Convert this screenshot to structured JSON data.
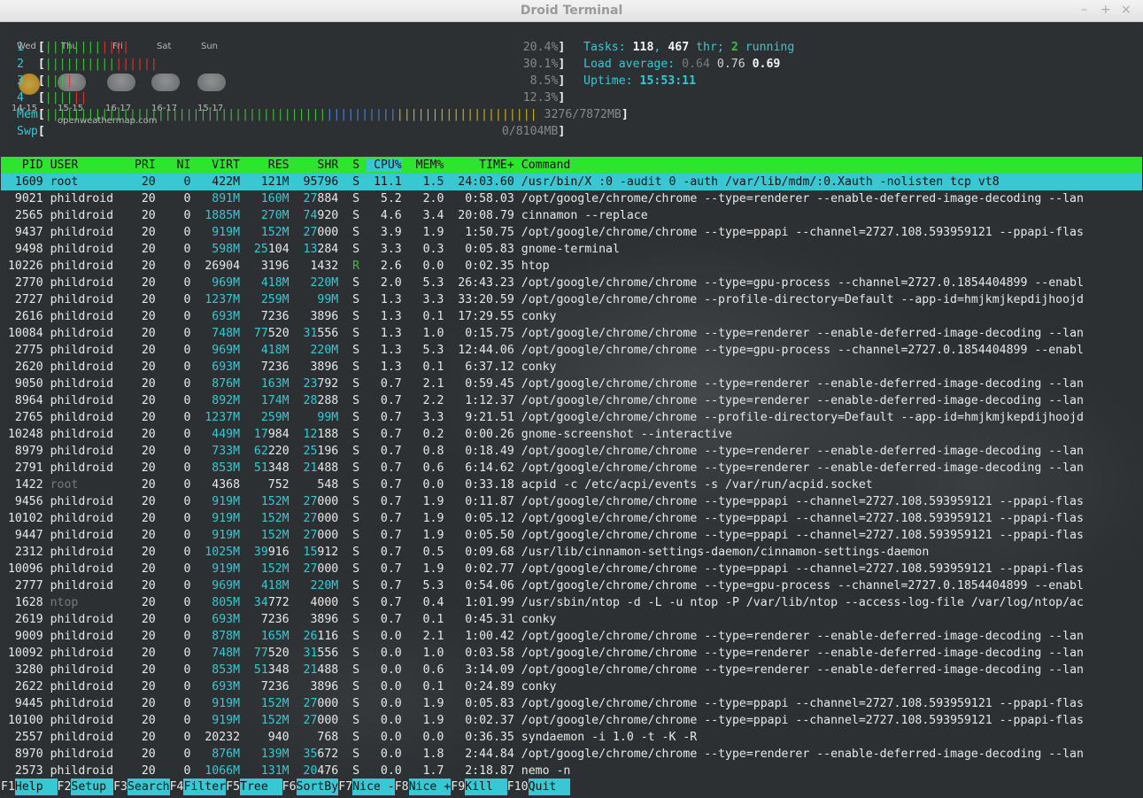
{
  "window": {
    "title": "Droid Terminal",
    "controls": [
      "–",
      "+",
      "×"
    ]
  },
  "weather": {
    "days": [
      "Wed",
      "Thu",
      "Fri",
      "Sat",
      "Sun"
    ],
    "ranges": [
      "14-15",
      "15-15",
      "16-17",
      "16-17",
      "15-17"
    ],
    "source": "openweathermap.com"
  },
  "meters": [
    {
      "label": "1",
      "value": "20.4%"
    },
    {
      "label": "2",
      "value": "30.1%"
    },
    {
      "label": "3",
      "value": "8.5%"
    },
    {
      "label": "4",
      "value": "12.3%"
    },
    {
      "label": "Mem",
      "value": "3276/7872MB"
    },
    {
      "label": "Swp",
      "value": "0/8104MB"
    }
  ],
  "stats": {
    "tasks_label": "Tasks:",
    "tasks": "118",
    "threads": "467",
    "thr_label": "thr;",
    "running": "2",
    "running_label": "running",
    "load_label": "Load average:",
    "load1": "0.64",
    "load5": "0.76",
    "load15": "0.69",
    "uptime_label": "Uptime:",
    "uptime": "15:53:11"
  },
  "columns": [
    "PID",
    "USER",
    "PRI",
    "NI",
    "VIRT",
    "RES",
    "SHR",
    "S",
    "CPU%",
    "MEM%",
    "TIME+",
    "Command"
  ],
  "processes": [
    [
      "1609",
      "root",
      "20",
      "0",
      "422M",
      "121M",
      "95796",
      "S",
      "11.1",
      "1.5",
      "24:03.60",
      "/usr/bin/X :0 -audit 0 -auth /var/lib/mdm/:0.Xauth -nolisten tcp vt8"
    ],
    [
      "9021",
      "phildroid",
      "20",
      "0",
      "891M",
      "160M",
      "27884",
      "S",
      "5.2",
      "2.0",
      "0:58.03",
      "/opt/google/chrome/chrome --type=renderer --enable-deferred-image-decoding --lan"
    ],
    [
      "2565",
      "phildroid",
      "20",
      "0",
      "1885M",
      "270M",
      "74920",
      "S",
      "4.6",
      "3.4",
      "20:08.79",
      "cinnamon --replace"
    ],
    [
      "9437",
      "phildroid",
      "20",
      "0",
      "919M",
      "152M",
      "27000",
      "S",
      "3.9",
      "1.9",
      "1:50.75",
      "/opt/google/chrome/chrome --type=ppapi --channel=2727.108.593959121 --ppapi-flas"
    ],
    [
      "9498",
      "phildroid",
      "20",
      "0",
      "598M",
      "25104",
      "13284",
      "S",
      "3.3",
      "0.3",
      "0:05.83",
      "gnome-terminal"
    ],
    [
      "10226",
      "phildroid",
      "20",
      "0",
      "26904",
      "3196",
      "1432",
      "R",
      "2.6",
      "0.0",
      "0:02.35",
      "htop"
    ],
    [
      "2770",
      "phildroid",
      "20",
      "0",
      "969M",
      "418M",
      "220M",
      "S",
      "2.0",
      "5.3",
      "26:43.23",
      "/opt/google/chrome/chrome --type=gpu-process --channel=2727.0.1854404899 --enabl"
    ],
    [
      "2727",
      "phildroid",
      "20",
      "0",
      "1237M",
      "259M",
      "99M",
      "S",
      "1.3",
      "3.3",
      "33:20.59",
      "/opt/google/chrome/chrome --profile-directory=Default --app-id=hmjkmjkepdijhoojd"
    ],
    [
      "2616",
      "phildroid",
      "20",
      "0",
      "693M",
      "7236",
      "3896",
      "S",
      "1.3",
      "0.1",
      "17:29.55",
      "conky"
    ],
    [
      "10084",
      "phildroid",
      "20",
      "0",
      "748M",
      "77520",
      "31556",
      "S",
      "1.3",
      "1.0",
      "0:15.75",
      "/opt/google/chrome/chrome --type=renderer --enable-deferred-image-decoding --lan"
    ],
    [
      "2775",
      "phildroid",
      "20",
      "0",
      "969M",
      "418M",
      "220M",
      "S",
      "1.3",
      "5.3",
      "12:44.06",
      "/opt/google/chrome/chrome --type=gpu-process --channel=2727.0.1854404899 --enabl"
    ],
    [
      "2620",
      "phildroid",
      "20",
      "0",
      "693M",
      "7236",
      "3896",
      "S",
      "1.3",
      "0.1",
      "6:37.12",
      "conky"
    ],
    [
      "9050",
      "phildroid",
      "20",
      "0",
      "876M",
      "163M",
      "23792",
      "S",
      "0.7",
      "2.1",
      "0:59.45",
      "/opt/google/chrome/chrome --type=renderer --enable-deferred-image-decoding --lan"
    ],
    [
      "8964",
      "phildroid",
      "20",
      "0",
      "892M",
      "174M",
      "28288",
      "S",
      "0.7",
      "2.2",
      "1:12.37",
      "/opt/google/chrome/chrome --type=renderer --enable-deferred-image-decoding --lan"
    ],
    [
      "2765",
      "phildroid",
      "20",
      "0",
      "1237M",
      "259M",
      "99M",
      "S",
      "0.7",
      "3.3",
      "9:21.51",
      "/opt/google/chrome/chrome --profile-directory=Default --app-id=hmjkmjkepdijhoojd"
    ],
    [
      "10248",
      "phildroid",
      "20",
      "0",
      "449M",
      "17984",
      "12188",
      "S",
      "0.7",
      "0.2",
      "0:00.26",
      "gnome-screenshot --interactive"
    ],
    [
      "8979",
      "phildroid",
      "20",
      "0",
      "733M",
      "62220",
      "25196",
      "S",
      "0.7",
      "0.8",
      "0:18.49",
      "/opt/google/chrome/chrome --type=renderer --enable-deferred-image-decoding --lan"
    ],
    [
      "2791",
      "phildroid",
      "20",
      "0",
      "853M",
      "51348",
      "21488",
      "S",
      "0.7",
      "0.6",
      "6:14.62",
      "/opt/google/chrome/chrome --type=renderer --enable-deferred-image-decoding --lan"
    ],
    [
      "1422",
      "root",
      "20",
      "0",
      "4368",
      "752",
      "548",
      "S",
      "0.7",
      "0.0",
      "0:33.18",
      "acpid -c /etc/acpi/events -s /var/run/acpid.socket"
    ],
    [
      "9456",
      "phildroid",
      "20",
      "0",
      "919M",
      "152M",
      "27000",
      "S",
      "0.7",
      "1.9",
      "0:11.87",
      "/opt/google/chrome/chrome --type=ppapi --channel=2727.108.593959121 --ppapi-flas"
    ],
    [
      "10102",
      "phildroid",
      "20",
      "0",
      "919M",
      "152M",
      "27000",
      "S",
      "0.7",
      "1.9",
      "0:05.12",
      "/opt/google/chrome/chrome --type=ppapi --channel=2727.108.593959121 --ppapi-flas"
    ],
    [
      "9447",
      "phildroid",
      "20",
      "0",
      "919M",
      "152M",
      "27000",
      "S",
      "0.7",
      "1.9",
      "0:05.50",
      "/opt/google/chrome/chrome --type=ppapi --channel=2727.108.593959121 --ppapi-flas"
    ],
    [
      "2312",
      "phildroid",
      "20",
      "0",
      "1025M",
      "39916",
      "15912",
      "S",
      "0.7",
      "0.5",
      "0:09.68",
      "/usr/lib/cinnamon-settings-daemon/cinnamon-settings-daemon"
    ],
    [
      "10096",
      "phildroid",
      "20",
      "0",
      "919M",
      "152M",
      "27000",
      "S",
      "0.7",
      "1.9",
      "0:02.77",
      "/opt/google/chrome/chrome --type=ppapi --channel=2727.108.593959121 --ppapi-flas"
    ],
    [
      "2777",
      "phildroid",
      "20",
      "0",
      "969M",
      "418M",
      "220M",
      "S",
      "0.7",
      "5.3",
      "0:54.06",
      "/opt/google/chrome/chrome --type=gpu-process --channel=2727.0.1854404899 --enabl"
    ],
    [
      "1628",
      "ntop",
      "20",
      "0",
      "805M",
      "34772",
      "4000",
      "S",
      "0.7",
      "0.4",
      "1:01.99",
      "/usr/sbin/ntop -d -L -u ntop -P /var/lib/ntop --access-log-file /var/log/ntop/ac"
    ],
    [
      "2619",
      "phildroid",
      "20",
      "0",
      "693M",
      "7236",
      "3896",
      "S",
      "0.7",
      "0.1",
      "0:45.31",
      "conky"
    ],
    [
      "9009",
      "phildroid",
      "20",
      "0",
      "878M",
      "165M",
      "26116",
      "S",
      "0.0",
      "2.1",
      "1:00.42",
      "/opt/google/chrome/chrome --type=renderer --enable-deferred-image-decoding --lan"
    ],
    [
      "10092",
      "phildroid",
      "20",
      "0",
      "748M",
      "77520",
      "31556",
      "S",
      "0.0",
      "1.0",
      "0:03.58",
      "/opt/google/chrome/chrome --type=renderer --enable-deferred-image-decoding --lan"
    ],
    [
      "3280",
      "phildroid",
      "20",
      "0",
      "853M",
      "51348",
      "21488",
      "S",
      "0.0",
      "0.6",
      "3:14.09",
      "/opt/google/chrome/chrome --type=renderer --enable-deferred-image-decoding --lan"
    ],
    [
      "2622",
      "phildroid",
      "20",
      "0",
      "693M",
      "7236",
      "3896",
      "S",
      "0.0",
      "0.1",
      "0:24.89",
      "conky"
    ],
    [
      "9445",
      "phildroid",
      "20",
      "0",
      "919M",
      "152M",
      "27000",
      "S",
      "0.0",
      "1.9",
      "0:05.83",
      "/opt/google/chrome/chrome --type=ppapi --channel=2727.108.593959121 --ppapi-flas"
    ],
    [
      "10100",
      "phildroid",
      "20",
      "0",
      "919M",
      "152M",
      "27000",
      "S",
      "0.0",
      "1.9",
      "0:02.37",
      "/opt/google/chrome/chrome --type=ppapi --channel=2727.108.593959121 --ppapi-flas"
    ],
    [
      "2557",
      "phildroid",
      "20",
      "0",
      "20232",
      "940",
      "768",
      "S",
      "0.0",
      "0.0",
      "0:36.35",
      "syndaemon -i 1.0 -t -K -R"
    ],
    [
      "8970",
      "phildroid",
      "20",
      "0",
      "876M",
      "139M",
      "35672",
      "S",
      "0.0",
      "1.8",
      "2:44.84",
      "/opt/google/chrome/chrome --type=renderer --enable-deferred-image-decoding --lan"
    ],
    [
      "2573",
      "phildroid",
      "20",
      "0",
      "1066M",
      "131M",
      "20476",
      "S",
      "0.0",
      "1.7",
      "2:18.87",
      "nemo -n"
    ]
  ],
  "function_keys": [
    {
      "key": "F1",
      "label": "Help  "
    },
    {
      "key": "F2",
      "label": "Setup "
    },
    {
      "key": "F3",
      "label": "Search"
    },
    {
      "key": "F4",
      "label": "Filter"
    },
    {
      "key": "F5",
      "label": "Tree  "
    },
    {
      "key": "F6",
      "label": "SortBy"
    },
    {
      "key": "F7",
      "label": "Nice -"
    },
    {
      "key": "F8",
      "label": "Nice +"
    },
    {
      "key": "F9",
      "label": "Kill  "
    },
    {
      "key": "F10",
      "label": "Quit  "
    }
  ],
  "colors": {
    "header_bg": "#2ee42e",
    "selection_bg": "#37c8d4",
    "accent_cyan": "#37c8d4",
    "terminal_bg": "#2d3032"
  }
}
